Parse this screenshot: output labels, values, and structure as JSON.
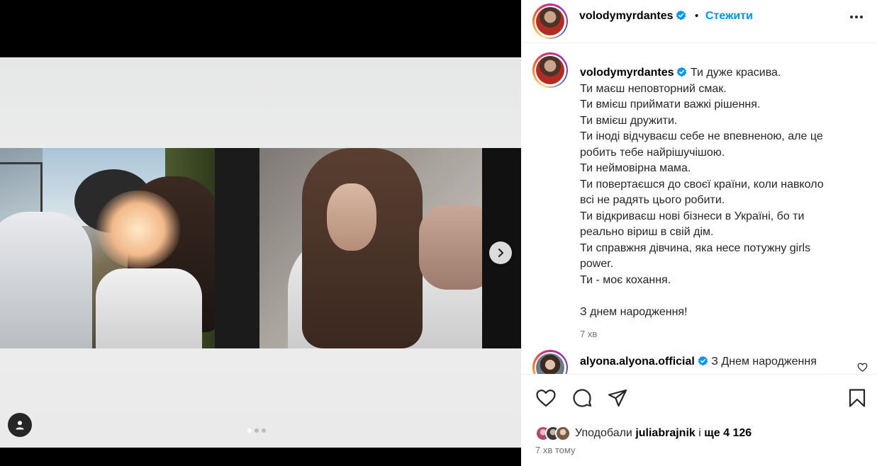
{
  "post": {
    "username": "volodymyrdantes",
    "follow_label": "Стежити",
    "separator": "•",
    "caption_lines": [
      "Ти дуже красива.",
      "Ти маєш неповторний смак.",
      "Ти вмієш приймати важкі рішення.",
      "Ти вмієш дружити.",
      "Ти іноді відчуваєш себе не впевненою, але це",
      "робить тебе найрішучішою.",
      "Ти неймовірна мама.",
      "Ти повертаєшся до своєї країни, коли навколо",
      "всі не радять цього робити.",
      "Ти відкриваєш нові бізнеси в Україні, бо ти",
      "реально віриш в свій дім.",
      "Ти справжня дівчина, яка несе потужну girls",
      "power.",
      "Ти - моє кохання.",
      "",
      "З днем народження!"
    ],
    "caption_time": "7 хв",
    "carousel": {
      "current": 1,
      "total": 3
    }
  },
  "comments": [
    {
      "username": "alyona.alyona.official",
      "text": "З Днем народження"
    }
  ],
  "likes": {
    "prefix": "Уподобали",
    "user": "juliabrajnik",
    "middle": "і",
    "count_text": "ще 4 126"
  },
  "posted_time": "7 хв тому",
  "icons": [
    "more-icon",
    "heart-icon",
    "comment-icon",
    "share-icon",
    "bookmark-icon",
    "chevron-right-icon",
    "user-tag-icon",
    "verified-icon"
  ],
  "colors": {
    "accent": "#0095f6",
    "verified": "#0095f6",
    "muted": "#737373"
  }
}
